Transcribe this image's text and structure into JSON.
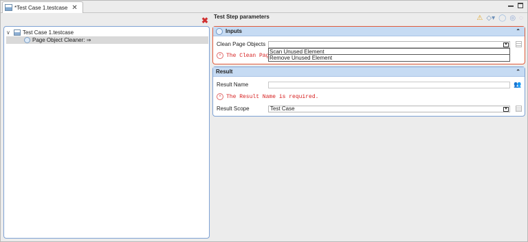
{
  "tab": {
    "label": "*Test Case 1.testcase",
    "close": "✕"
  },
  "tree": {
    "root": {
      "chevron": "∨",
      "label": "Test Case 1.testcase"
    },
    "child": {
      "label": "Page Object Cleaner: ⇒"
    }
  },
  "params_title": "Test Step parameters",
  "inputs": {
    "header": "Inputs",
    "collapse": "⌃",
    "clean_label": "Clean Page Objects",
    "clean_value": "",
    "error": "The Clean Page",
    "dropdown_options": [
      "Scan Unused Element",
      "Remove Unused Element"
    ]
  },
  "result": {
    "header": "Result",
    "collapse": "⌃",
    "name_label": "Result Name",
    "name_value": "",
    "error": "The Result Name is required.",
    "scope_label": "Result Scope",
    "scope_value": "Test Case"
  },
  "icons": {
    "delete": "✖",
    "error": "×",
    "arrow": "▼",
    "people": "👥"
  }
}
